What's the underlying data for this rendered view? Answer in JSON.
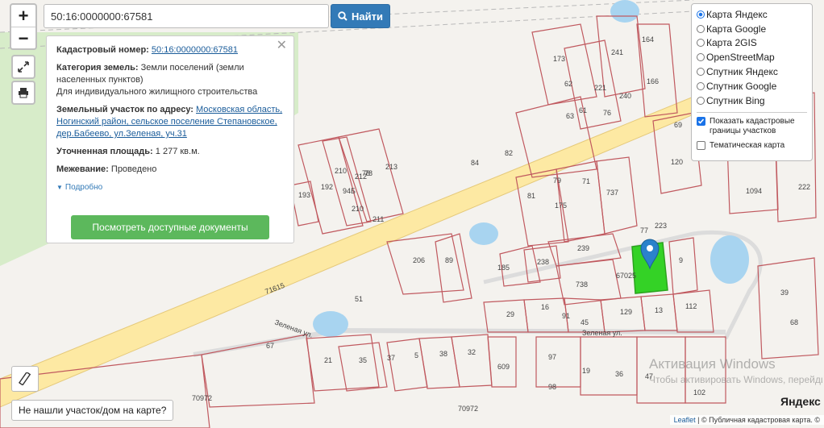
{
  "search": {
    "value": "50:16:0000000:67581",
    "button_label": "Найти"
  },
  "popup": {
    "cad_label": "Кадастровый номер:",
    "cad_value": "50:16:0000000:67581",
    "cat_label": "Категория земель:",
    "cat_value": "Земли поселений (земли населенных пунктов)",
    "cat_use": "Для индивидуального жилищного строительства",
    "addr_label": "Земельный участок по адресу:",
    "addr_value": "Московская область, Ногинский район, сельское поселение Степановское, дер.Бабеево, ул.Зеленая, уч.31",
    "area_label": "Уточненная площадь:",
    "area_value": "1 277 кв.м.",
    "survey_label": "Межевание:",
    "survey_value": "Проведено",
    "more_label": "Подробно",
    "docs_button": "Посмотреть доступные документы"
  },
  "layers": {
    "options": [
      {
        "label": "Карта Яндекс",
        "selected": true
      },
      {
        "label": "Карта Google",
        "selected": false
      },
      {
        "label": "Карта 2GIS",
        "selected": false
      },
      {
        "label": "OpenStreetMap",
        "selected": false
      },
      {
        "label": "Спутник Яндекс",
        "selected": false
      },
      {
        "label": "Спутник Google",
        "selected": false
      },
      {
        "label": "Спутник Bing",
        "selected": false
      }
    ],
    "show_borders": "Показать кадастровые границы участков",
    "show_borders_checked": true,
    "thematic": "Тематическая карта",
    "thematic_checked": false
  },
  "zoom": {
    "in": "+",
    "out": "−"
  },
  "not_found": "Не нашли участок/дом на карте?",
  "attribution": {
    "leaflet": "Leaflet",
    "sep": " | © ",
    "pkk": "Публичная кадастровая карта",
    "copy": ". ©"
  },
  "watermark": {
    "line1": "Активация Windows",
    "line2": "Чтобы активировать Windows, перейдите в раздел \"Параметры\"."
  },
  "yandex_logo": "Яндекс",
  "map": {
    "road_label": "71615",
    "street_zelenaya_1": "Зеленая ул.",
    "street_zelenaya_2": "Зеленая ул.",
    "parcel_labels": [
      "173",
      "62",
      "221",
      "164",
      "241",
      "166",
      "76",
      "240",
      "61",
      "63",
      "69",
      "84",
      "82",
      "120",
      "210",
      "212",
      "213",
      "193",
      "192",
      "94Б",
      "210",
      "211",
      "78",
      "79",
      "71",
      "1094",
      "222",
      "81",
      "737",
      "175",
      "77",
      "223",
      "206",
      "89",
      "185",
      "238",
      "239",
      "738",
      "67025",
      "9",
      "51",
      "91",
      "45",
      "129",
      "13",
      "112",
      "16",
      "29",
      "39",
      "67",
      "21",
      "35",
      "37",
      "5",
      "38",
      "32",
      "609",
      "97",
      "19",
      "36",
      "47",
      "98",
      "102",
      "68",
      "70972",
      "70972",
      "78"
    ],
    "colors": {
      "parcel_line": "#c0595f",
      "road": "#fde9a3",
      "water": "#a8d4f0",
      "forest": "#d9eccd",
      "highlight": "#34d226"
    }
  }
}
